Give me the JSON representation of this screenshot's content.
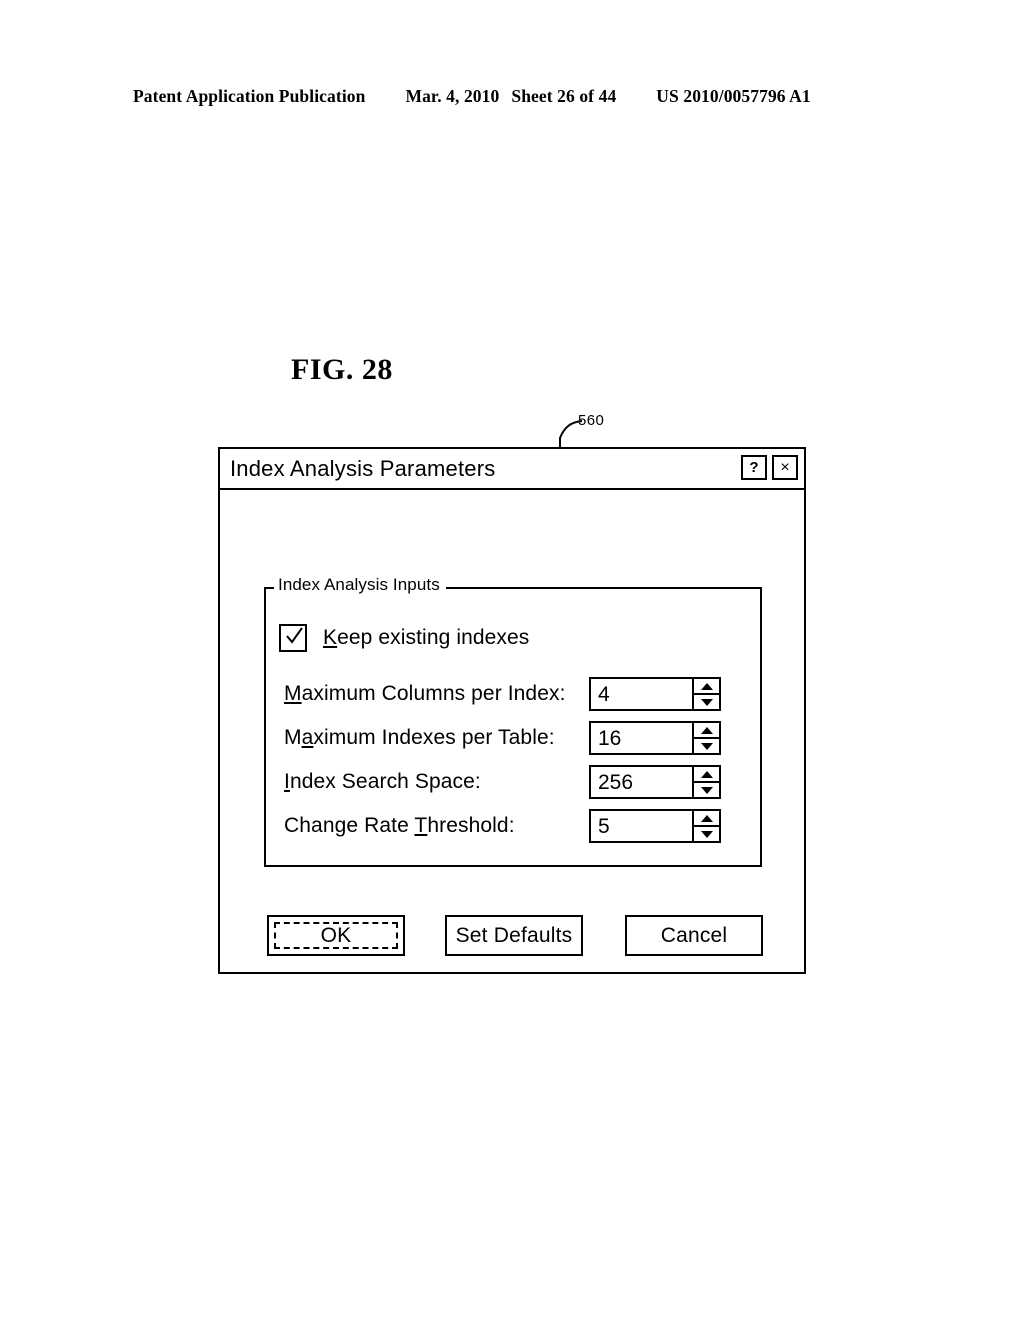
{
  "page_header": {
    "publication": "Patent Application Publication",
    "date": "Mar. 4, 2010",
    "sheet": "Sheet 26 of 44",
    "patent_number": "US 2010/0057796 A1"
  },
  "figure": {
    "label": "FIG. 28",
    "reference_numeral": "560"
  },
  "dialog": {
    "title": "Index Analysis Parameters",
    "help_button": "?",
    "close_button": "×",
    "group": {
      "legend": "Index Analysis Inputs",
      "checkbox": {
        "label": "Keep existing indexes",
        "mnemonic": "K",
        "checked": true
      },
      "fields": [
        {
          "label_prefix": "",
          "mnemonic": "M",
          "label_suffix": "aximum Columns per Index:",
          "label_full": "Maximum Columns per Index:",
          "value": "4"
        },
        {
          "label_prefix": "M",
          "mnemonic": "a",
          "label_suffix": "ximum Indexes per Table:",
          "label_full": "Maximum Indexes per Table:",
          "value": "16"
        },
        {
          "label_prefix": "",
          "mnemonic": "I",
          "label_suffix": "ndex Search Space:",
          "label_full": "Index Search Space:",
          "value": "256"
        },
        {
          "label_prefix": "Change Rate ",
          "mnemonic": "T",
          "label_suffix": "hreshold:",
          "label_full": "Change Rate Threshold:",
          "value": "5"
        }
      ]
    },
    "buttons": {
      "ok": "OK",
      "set_defaults": "Set Defaults",
      "cancel": "Cancel"
    }
  },
  "colors": {
    "ink": "#000000",
    "paper": "#ffffff"
  }
}
